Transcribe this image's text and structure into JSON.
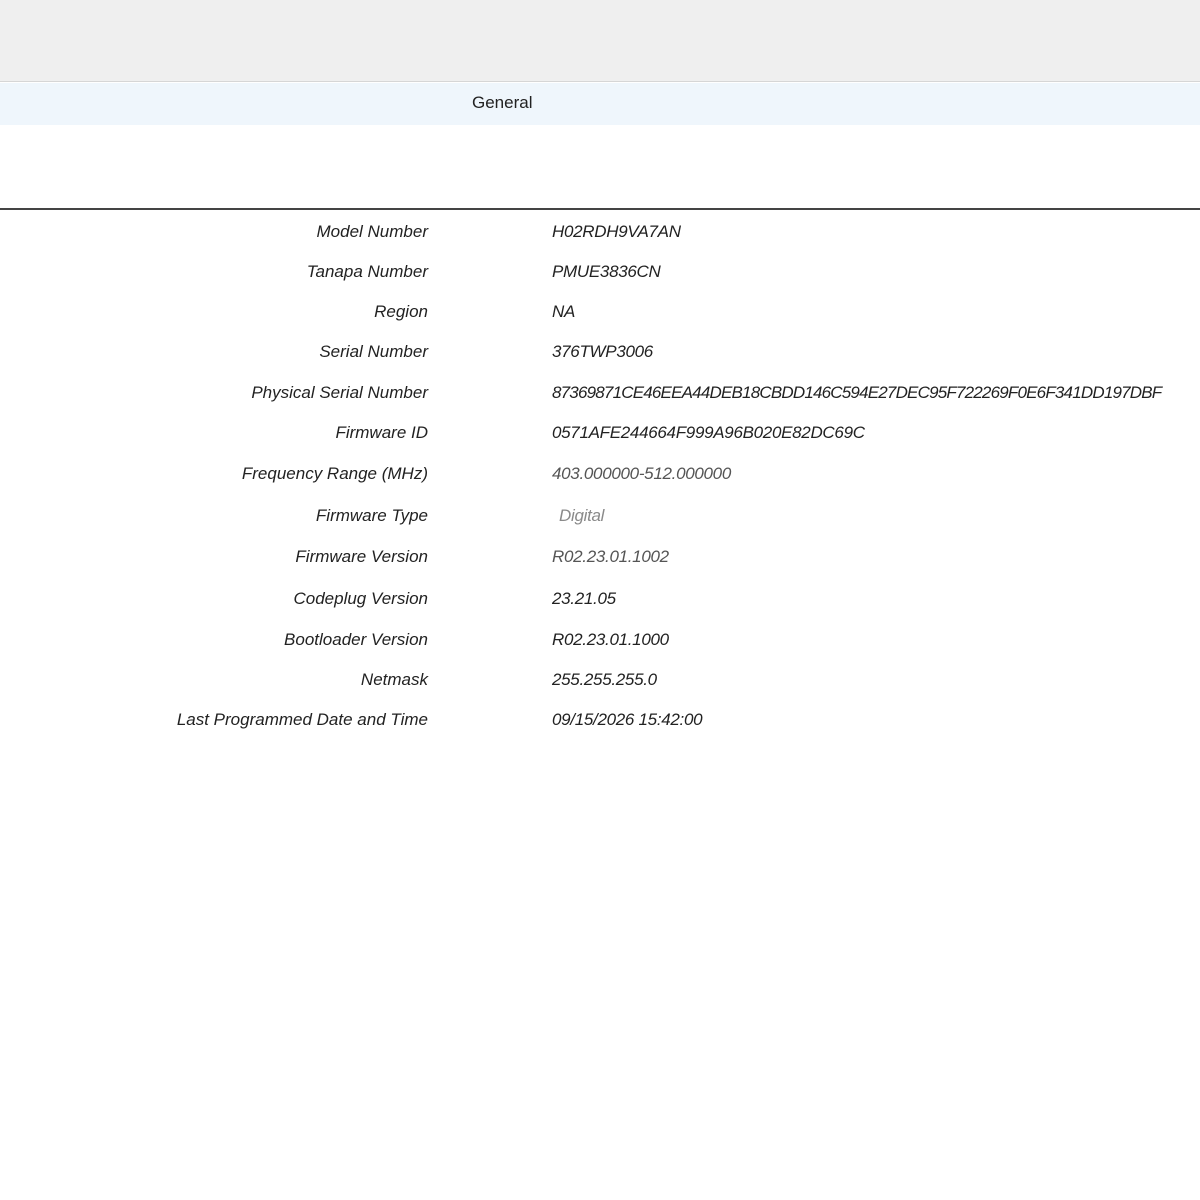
{
  "section": {
    "title": "General"
  },
  "fields": [
    {
      "label": "Model Number",
      "value": "H02RDH9VA7AN"
    },
    {
      "label": "Tanapa Number",
      "value": "PMUE3836CN"
    },
    {
      "label": "Region",
      "value": "NA"
    },
    {
      "label": "Serial Number",
      "value": "376TWP3006"
    },
    {
      "label": "Physical Serial Number",
      "value": "87369871CE46EEA44DEB18CBDD146C594E27DEC95F722269F0E6F341DD197DBF"
    },
    {
      "label": "Firmware ID",
      "value": "0571AFE244664F999A96B020E82DC69C"
    },
    {
      "label": "Frequency Range (MHz)",
      "value": "403.000000-512.000000"
    },
    {
      "label": "Firmware Type",
      "value": "Digital"
    },
    {
      "label": "Firmware Version",
      "value": "R02.23.01.1002"
    },
    {
      "label": "Codeplug Version",
      "value": "23.21.05"
    },
    {
      "label": "Bootloader Version",
      "value": "R02.23.01.1000"
    },
    {
      "label": "Netmask",
      "value": "255.255.255.0"
    },
    {
      "label": "Last Programmed Date and Time",
      "value": "09/15/2026 15:42:00"
    }
  ]
}
